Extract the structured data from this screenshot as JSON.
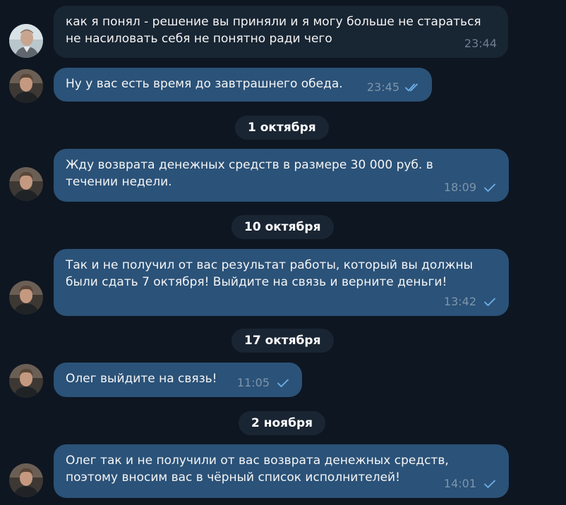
{
  "chat": {
    "messages": [
      {
        "text": "как я понял - решение вы приняли и я могу больше не стараться\nне насиловать себя не понятно ради чего",
        "time": "23:44",
        "direction": "incoming",
        "status": "none",
        "avatar": "contact-avatar"
      },
      {
        "text": "Ну у вас есть время до завтрашнего обеда.",
        "time": "23:45",
        "direction": "outgoing",
        "status": "read",
        "avatar": "user-avatar"
      },
      {
        "text": "Жду возврата денежных средств в размере 30 000 руб. в\nтечении недели.",
        "time": "18:09",
        "direction": "outgoing",
        "status": "sent",
        "avatar": "user-avatar"
      },
      {
        "text": "Так и не получил от вас результат работы, который вы должны\nбыли сдать 7 октября! Выйдите на связь и верните деньги!",
        "time": "13:42",
        "direction": "outgoing",
        "status": "sent",
        "avatar": "user-avatar"
      },
      {
        "text": "Олег выйдите на связь!",
        "time": "11:05",
        "direction": "outgoing",
        "status": "sent",
        "avatar": "user-avatar"
      },
      {
        "text": "Олег так и не получили от вас возврата денежных средств,\nпоэтому вносим вас в чёрный список исполнителей!",
        "time": "14:01",
        "direction": "outgoing",
        "status": "sent",
        "avatar": "user-avatar"
      }
    ],
    "date_separators": [
      "1 октября",
      "10 октября",
      "17 октября",
      "2 ноября"
    ]
  },
  "colors": {
    "background": "#0e1621",
    "incoming_bubble": "#182533",
    "outgoing_bubble": "#2b5278",
    "check": "#6fb1ea",
    "date_pill": "#1a2533"
  }
}
